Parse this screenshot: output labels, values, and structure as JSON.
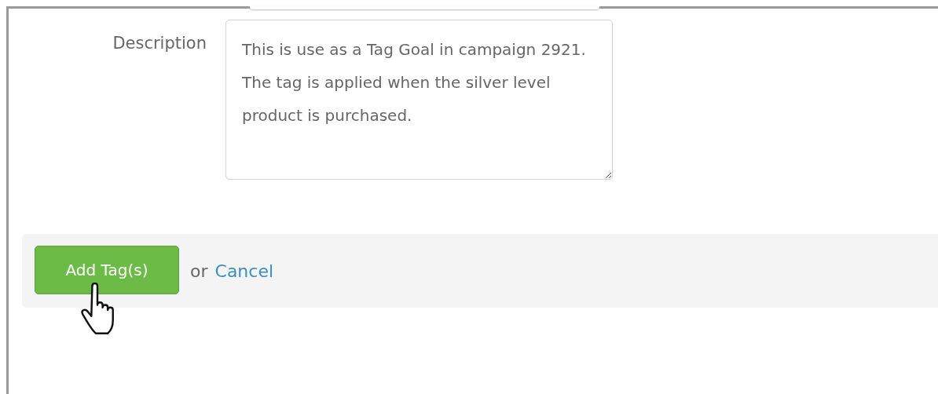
{
  "form": {
    "fields": [
      {
        "label": "Description",
        "value": "This is use as a Tag Goal in campaign 2921. The tag is applied when the silver level product is purchased."
      }
    ]
  },
  "actions": {
    "submit": "Add Tag(s)",
    "separator": "or",
    "cancel": "Cancel"
  }
}
